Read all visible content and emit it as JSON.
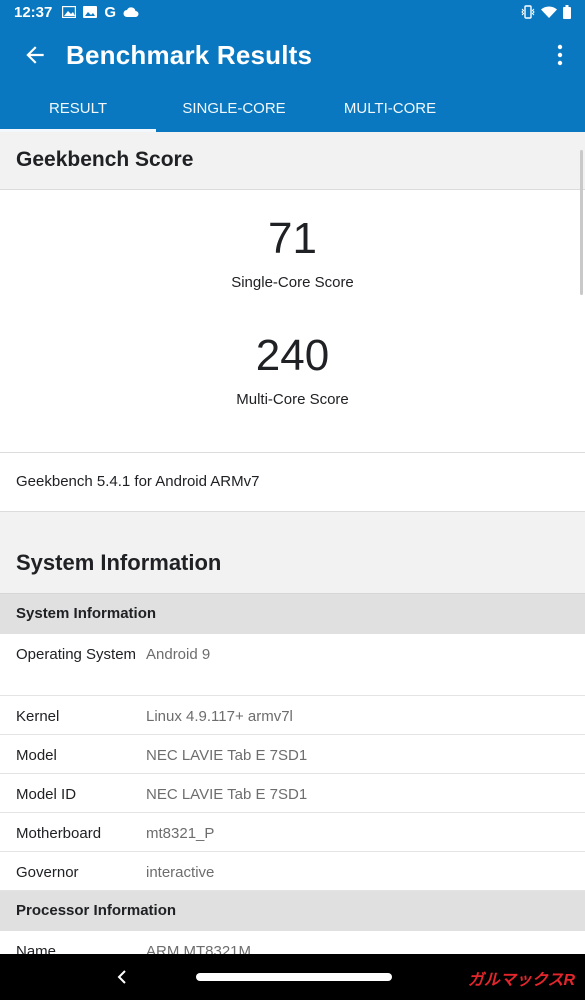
{
  "status_bar": {
    "time": "12:37",
    "left_icons": [
      "image-icon",
      "photo-icon",
      "google-g-icon",
      "cloud-icon"
    ],
    "google_letter": "G",
    "right_icons": [
      "vibrate-icon",
      "wifi-icon",
      "battery-icon"
    ]
  },
  "app_bar": {
    "title": "Benchmark Results",
    "color": "#0a78c0"
  },
  "tabs": [
    {
      "label": "RESULT",
      "active": true
    },
    {
      "label": "SINGLE-CORE",
      "active": false
    },
    {
      "label": "MULTI-CORE",
      "active": false
    }
  ],
  "geekbench": {
    "heading": "Geekbench Score",
    "single_score": "71",
    "single_label": "Single-Core Score",
    "multi_score": "240",
    "multi_label": "Multi-Core Score",
    "version": "Geekbench 5.4.1 for Android ARMv7"
  },
  "system_information": {
    "title": "System Information",
    "subhead": "System Information",
    "rows": [
      {
        "key": "Operating System",
        "value": "Android 9"
      },
      {
        "key": "Kernel",
        "value": "Linux 4.9.117+ armv7l"
      },
      {
        "key": "Model",
        "value": "NEC LAVIE Tab E 7SD1"
      },
      {
        "key": "Model ID",
        "value": "NEC LAVIE Tab E 7SD1"
      },
      {
        "key": "Motherboard",
        "value": "mt8321_P"
      },
      {
        "key": "Governor",
        "value": "interactive"
      }
    ],
    "processor_subhead": "Processor Information",
    "processor_rows": [
      {
        "key": "Name",
        "value": "ARM MT8321M"
      }
    ]
  },
  "nav_bar": {
    "watermark": "ガルマックスR"
  }
}
